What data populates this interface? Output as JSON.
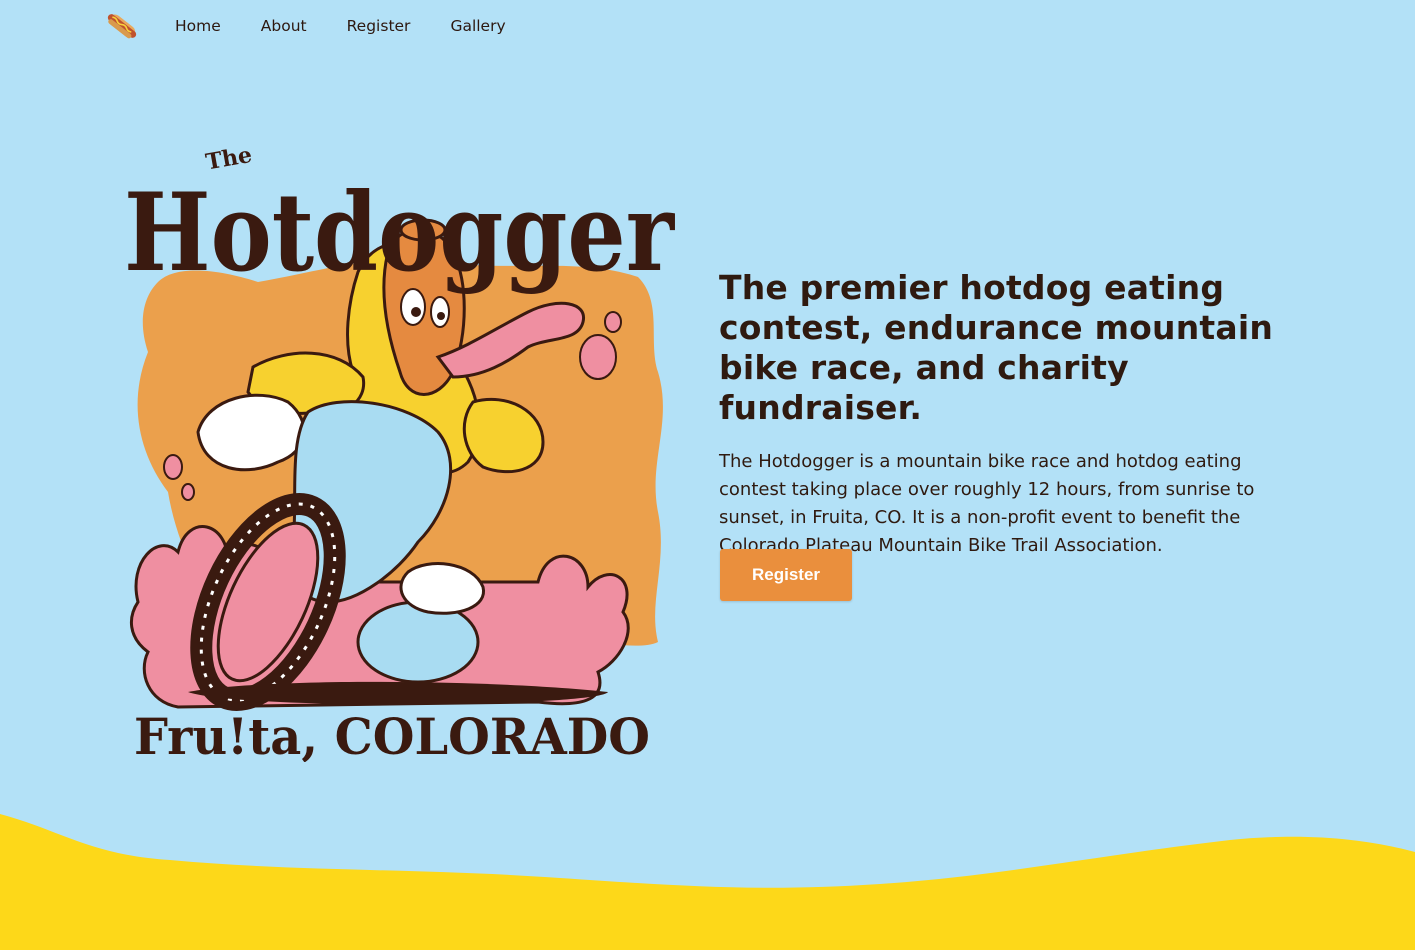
{
  "nav": {
    "logo_icon": "hotdog-icon",
    "items": [
      {
        "label": "Home"
      },
      {
        "label": "About"
      },
      {
        "label": "Register"
      },
      {
        "label": "Gallery"
      }
    ]
  },
  "hero": {
    "art": {
      "title_small": "The",
      "title": "Hotdogger",
      "subtitle": "Fru!ta, COLORADO"
    },
    "heading": "The premier hotdog eating contest, endurance mountain bike race, and charity fundraiser.",
    "description": "The Hotdogger is a mountain bike race and hotdog eating contest taking place over roughly 12 hours, from sunrise to sunset, in Fruita, CO. It is a non-profit event to benefit the Colorado Plateau Mountain Bike Trail Association.",
    "cta_label": "Register"
  },
  "colors": {
    "background": "#b3e1f7",
    "accent": "#ea8f3d",
    "text": "#2f1a10",
    "wave": "#fdd819"
  }
}
